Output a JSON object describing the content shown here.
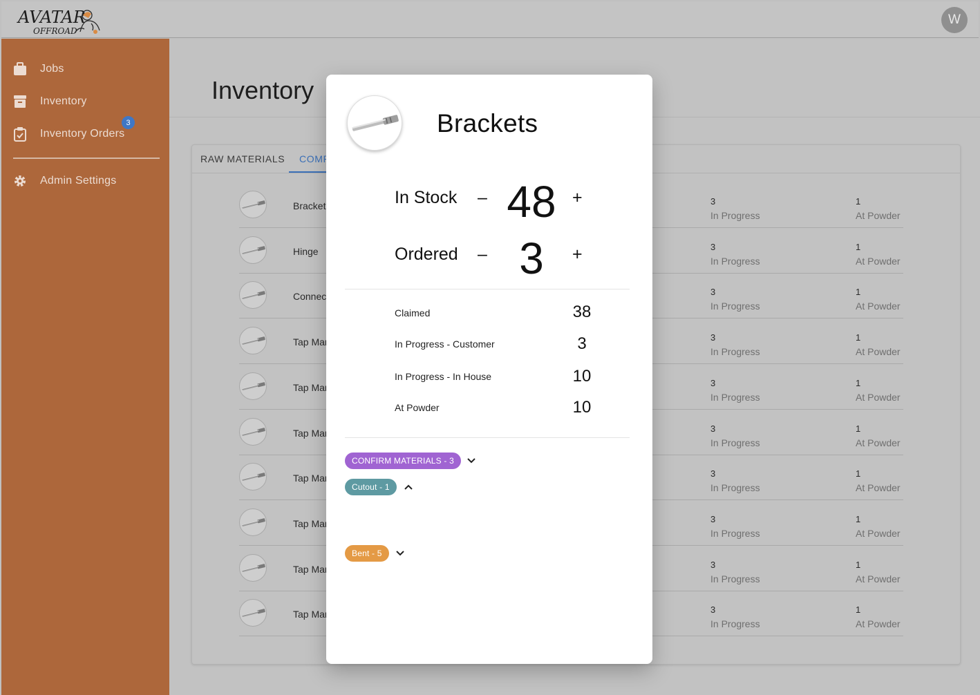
{
  "header": {
    "logo_text_top": "AVATAR",
    "logo_text_bottom": "OFFROAD",
    "user_initial": "W"
  },
  "sidebar": {
    "items": [
      {
        "label": "Jobs",
        "icon": "briefcase-icon"
      },
      {
        "label": "Inventory",
        "icon": "archive-box-icon"
      },
      {
        "label": "Inventory Orders",
        "icon": "clipboard-check-icon",
        "badge": "3"
      },
      {
        "label": "Admin Settings",
        "icon": "gear-icon"
      }
    ]
  },
  "main": {
    "title": "Inventory",
    "tabs": [
      {
        "label": "RAW MATERIALS"
      },
      {
        "label": "COMP"
      }
    ],
    "rows": [
      {
        "name": "Bracket",
        "in_progress": "3",
        "in_progress_label": "In Progress",
        "at_powder": "1",
        "at_powder_label": "At Powder"
      },
      {
        "name": "Hinge",
        "in_progress": "3",
        "in_progress_label": "In Progress",
        "at_powder": "1",
        "at_powder_label": "At Powder"
      },
      {
        "name": "Connec",
        "in_progress": "3",
        "in_progress_label": "In Progress",
        "at_powder": "1",
        "at_powder_label": "At Powder"
      },
      {
        "name": "Tap Mar",
        "in_progress": "3",
        "in_progress_label": "In Progress",
        "at_powder": "1",
        "at_powder_label": "At Powder"
      },
      {
        "name": "Tap Mar",
        "in_progress": "3",
        "in_progress_label": "In Progress",
        "at_powder": "1",
        "at_powder_label": "At Powder"
      },
      {
        "name": "Tap Mar",
        "in_progress": "3",
        "in_progress_label": "In Progress",
        "at_powder": "1",
        "at_powder_label": "At Powder"
      },
      {
        "name": "Tap Mar",
        "in_progress": "3",
        "in_progress_label": "In Progress",
        "at_powder": "1",
        "at_powder_label": "At Powder"
      },
      {
        "name": "Tap Mar",
        "in_progress": "3",
        "in_progress_label": "In Progress",
        "at_powder": "1",
        "at_powder_label": "At Powder"
      },
      {
        "name": "Tap Mar",
        "in_progress": "3",
        "in_progress_label": "In Progress",
        "at_powder": "1",
        "at_powder_label": "At Powder"
      },
      {
        "name": "Tap Mar",
        "in_progress": "3",
        "in_progress_label": "In Progress",
        "at_powder": "1",
        "at_powder_label": "At Powder"
      }
    ]
  },
  "modal": {
    "title": "Brackets",
    "in_stock": {
      "label": "In Stock",
      "minus": "–",
      "value": "48",
      "plus": "+"
    },
    "ordered": {
      "label": "Ordered",
      "minus": "–",
      "value": "3",
      "plus": "+"
    },
    "details": [
      {
        "label": "Claimed",
        "value": "38"
      },
      {
        "label": "In Progress - Customer",
        "value": "3"
      },
      {
        "label": "In Progress -  In House",
        "value": "10"
      },
      {
        "label": "At Powder",
        "value": "10"
      }
    ],
    "chips": [
      {
        "label": "CONFIRM MATERIALS - 3",
        "color": "#a064d2",
        "expanded": false
      },
      {
        "label": "Cutout - 1",
        "color": "#5e9aa2",
        "expanded": true
      },
      {
        "label": "Bent - 5",
        "color": "#e49a45",
        "expanded": false
      }
    ]
  },
  "colors": {
    "sidebar": "#ad673b",
    "accent": "#3a6fb7",
    "badge": "#3f77c5"
  }
}
